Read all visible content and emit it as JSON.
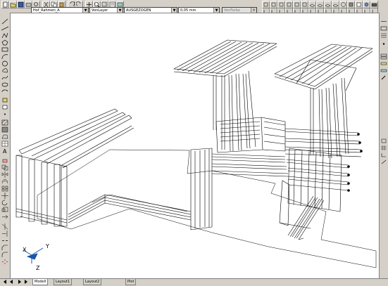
{
  "toolbar": {
    "dropdowns": {
      "layer": "Hof_Rahmen_A",
      "color": "VonLayer",
      "linetype": "AUSGEZOGEN",
      "lineweight": "0,05 mm",
      "plotstyle": "VonFarbe"
    }
  },
  "ucs": {
    "x": "X",
    "y": "Y",
    "z": "Z"
  },
  "tabs": [
    "Modell",
    "Layout1",
    "Layout2",
    "Plot"
  ],
  "colors": {
    "ui_bg": "#d4d0c8",
    "canvas": "#ffffff",
    "ink": "#000000",
    "ucs_accent": "#1a56a8"
  }
}
